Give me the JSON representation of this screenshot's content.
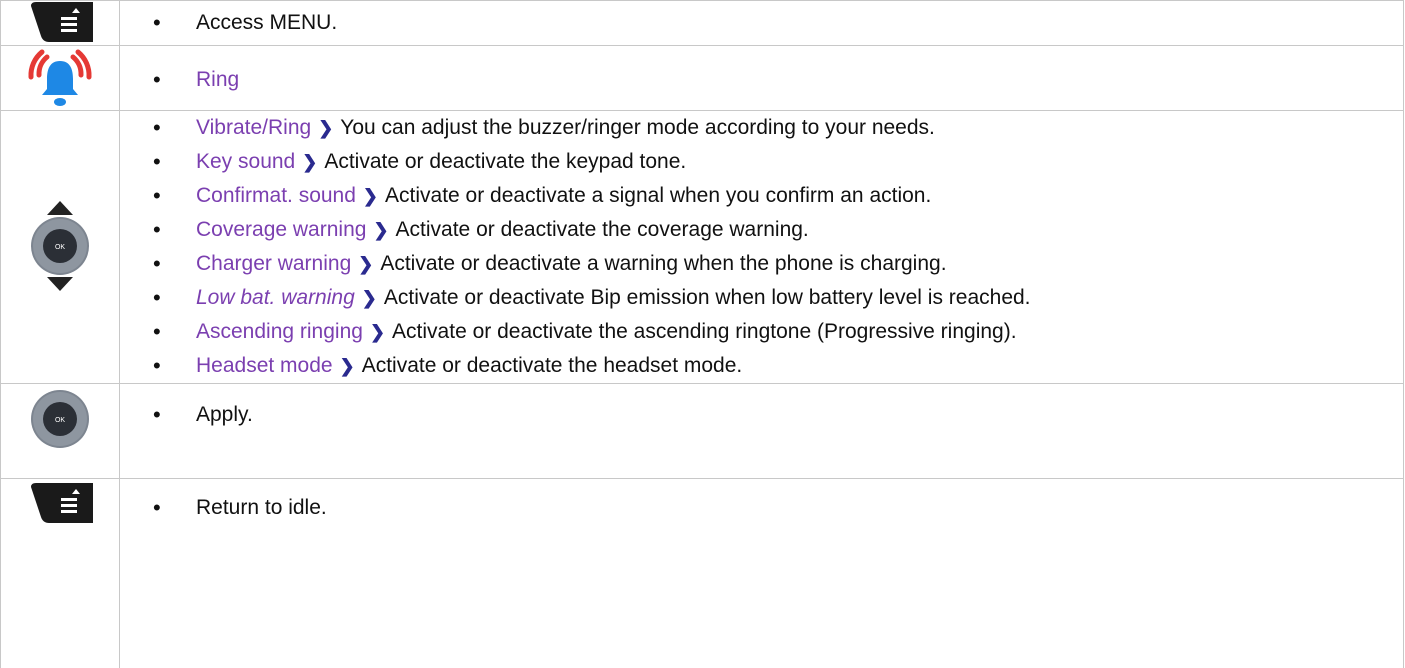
{
  "rows": [
    {
      "icon": "menu-key-icon",
      "items": [
        {
          "text": "Access MENU."
        }
      ]
    },
    {
      "icon": "ring-bell-icon",
      "items": [
        {
          "term": "Ring"
        }
      ]
    },
    {
      "icon": "navigator-ok-icon",
      "items": [
        {
          "term": "Vibrate/Ring",
          "sep": "❯",
          "desc": "You can adjust the buzzer/ringer mode according to your needs."
        },
        {
          "term": "Key sound",
          "sep": "❯",
          "desc": "Activate or deactivate the keypad tone."
        },
        {
          "term": "Confirmat. sound",
          "sep": "❯",
          "desc": "Activate or deactivate a signal when you confirm an action."
        },
        {
          "term": "Coverage warning",
          "sep": "❯",
          "desc": "Activate or deactivate the coverage warning."
        },
        {
          "term": "Charger warning",
          "sep": "❯",
          "desc": "Activate or deactivate a warning when the phone is charging."
        },
        {
          "term": "Low bat. warning",
          "sep": "❯",
          "desc": "Activate or deactivate Bip emission when low battery level is reached."
        },
        {
          "term": "Ascending ringing",
          "sep": "❯",
          "desc": "Activate or deactivate the ascending ringtone (Progressive ringing)."
        },
        {
          "term": "Headset mode",
          "sep": "❯",
          "desc": "Activate or deactivate the headset mode."
        }
      ]
    },
    {
      "icon": "ok-key-icon",
      "items": [
        {
          "text": "Apply."
        }
      ]
    },
    {
      "icon": "menu-key-icon",
      "items": [
        {
          "text": "Return to idle."
        }
      ]
    }
  ],
  "icon_labels": {
    "ok": "OK"
  },
  "colors": {
    "term": "#7b3fb0",
    "separator": "#2a2a8f",
    "bell": "#1e88e5",
    "waves": "#e53935",
    "key": "#1a1a1a",
    "navigator_ring": "#7d8590"
  }
}
